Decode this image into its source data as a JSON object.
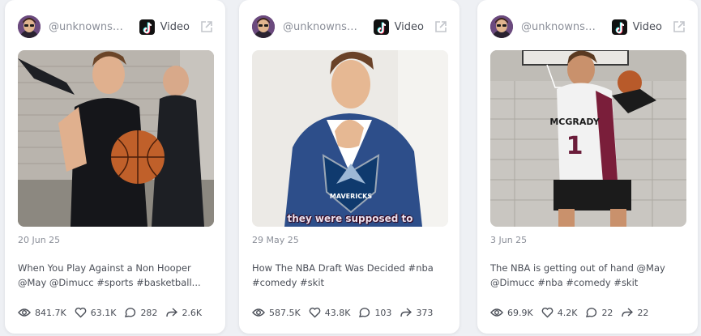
{
  "cards": [
    {
      "handle": "@unknownsm...",
      "platform": "Video",
      "date": "20 Jun 25",
      "description": "When You Play Against a Non Hooper @May @Dimucc #sports #basketball...",
      "caption": "",
      "stats": {
        "views": "841.7K",
        "likes": "63.1K",
        "comments": "282",
        "shares": "2.6K"
      }
    },
    {
      "handle": "@unknownsm...",
      "platform": "Video",
      "date": "29 May 25",
      "description": "How The NBA Draft Was Decided #nba #comedy #skit",
      "caption": "they were supposed to",
      "stats": {
        "views": "587.5K",
        "likes": "43.8K",
        "comments": "103",
        "shares": "373"
      }
    },
    {
      "handle": "@unknownsm...",
      "platform": "Video",
      "date": "3 Jun 25",
      "description": "The NBA is getting out of hand @May @Dimucc #nba #comedy #skit",
      "caption": "",
      "stats": {
        "views": "69.9K",
        "likes": "4.2K",
        "comments": "22",
        "shares": "22"
      }
    }
  ],
  "icons": {
    "platform": "tiktok-icon",
    "external": "external-link-icon",
    "views": "eye-icon",
    "likes": "heart-icon",
    "comments": "comment-icon",
    "shares": "share-icon"
  },
  "colors": {
    "card_bg": "#ffffff",
    "page_bg": "#eef0f4",
    "muted_text": "#8b8f99",
    "body_text": "#4a4e57"
  }
}
